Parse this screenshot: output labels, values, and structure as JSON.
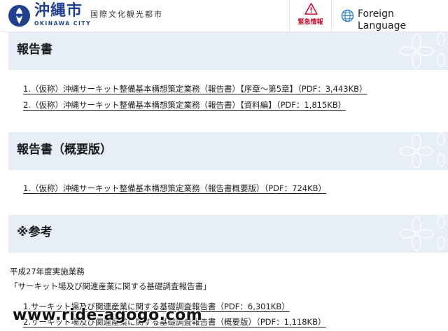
{
  "header": {
    "city_name": "沖縄市",
    "city_name_en": "OKINAWA CITY",
    "tagline": "国際文化観光都市",
    "emergency_label": "緊急情報",
    "foreign_label": "Foreign\nLanguage",
    "brand_color": "#1f3f8f",
    "emergency_color": "#c8102e"
  },
  "sections": [
    {
      "title": "報告書",
      "links": [
        "1.（仮称）沖縄サーキット整備基本構想策定業務（報告書）【序章〜第5章】（PDF：3,443KB）",
        "2.（仮称）沖縄サーキット整備基本構想策定業務（報告書）【資料編】（PDF：1,815KB）"
      ]
    },
    {
      "title": "報告書（概要版）",
      "links": [
        "1.（仮称）沖縄サーキット整備基本構想策定業務（報告書概要版）（PDF：724KB）"
      ]
    },
    {
      "title": "※参考",
      "notes": [
        "平成27年度実施業務",
        "「サーキット場及び関連産業に関する基礎調査報告書」"
      ],
      "links": [
        "1.サーキット場及び関連産業に関する基礎調査報告書（PDF：6,301KB）",
        "2.サーキット場及び関連産業に関する基礎調査報告書（概要版）（PDF：1,118KB）"
      ]
    }
  ],
  "section_bar_color": "#e7eef7",
  "watermark": "www.ride-agogo.com"
}
